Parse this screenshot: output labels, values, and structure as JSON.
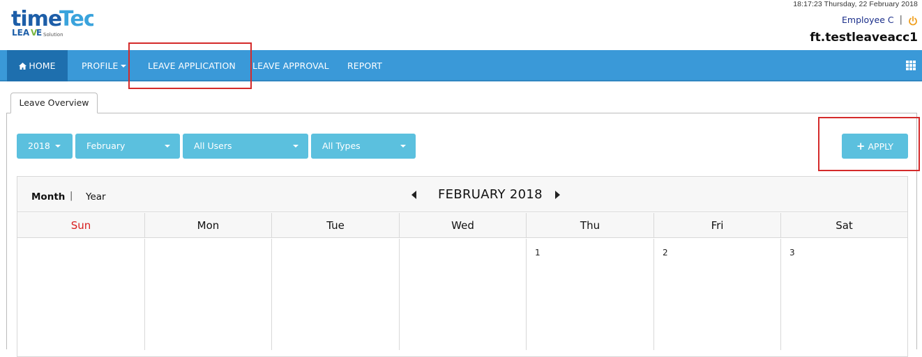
{
  "header": {
    "logo_text_main": "timeTec",
    "logo_text_sub": "LEAVE",
    "logo_text_solution": "Solution",
    "datetime": "18:17:23 Thursday, 22 February 2018",
    "employee_name": "Employee C",
    "separator": "|",
    "account_name": "ft.testleaveacc1"
  },
  "nav": {
    "home": "HOME",
    "profile": "PROFILE",
    "leave_application": "LEAVE APPLICATION",
    "leave_approval": "LEAVE APPROVAL",
    "report": "REPORT"
  },
  "tabs": [
    {
      "label": "Leave Overview"
    }
  ],
  "filters": {
    "year": "2018",
    "month": "February",
    "users": "All Users",
    "types": "All Types"
  },
  "apply_button": {
    "label": "APPLY"
  },
  "calendar": {
    "view_month": "Month",
    "view_separator": "|",
    "view_year": "Year",
    "title": "FEBRUARY 2018",
    "weekdays": [
      "Sun",
      "Mon",
      "Tue",
      "Wed",
      "Thu",
      "Fri",
      "Sat"
    ],
    "first_week": [
      "",
      "",
      "",
      "",
      "1",
      "2",
      "3"
    ]
  },
  "colors": {
    "nav_bg": "#3a99d8",
    "nav_active": "#1e6fae",
    "button_bg": "#5bc0de",
    "sunday": "#d81e1e",
    "highlight": "#d42a2a",
    "power_icon": "#f0a020"
  }
}
